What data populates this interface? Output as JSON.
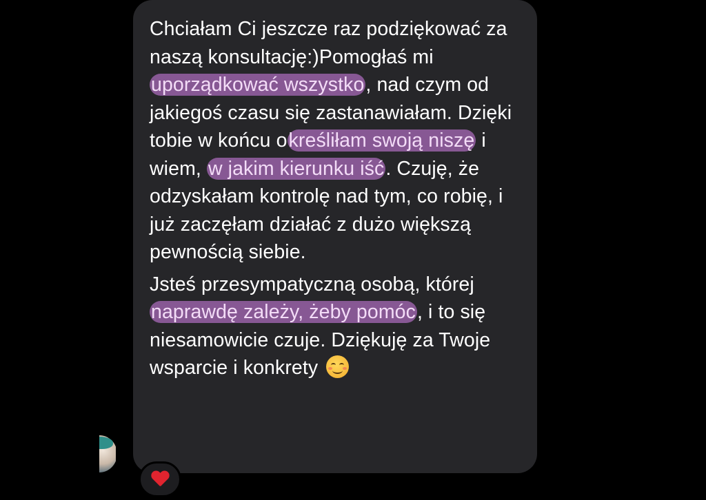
{
  "message": {
    "paragraph1": [
      {
        "text": "Chciałam Ci jeszcze raz podziękować za naszą konsultację:)Pomogłaś mi ",
        "highlight": false
      },
      {
        "text": "uporządkować wszystko",
        "highlight": true
      },
      {
        "text": ", nad czym od jakiegoś czasu się zastanawiałam. Dzięki tobie w końcu o",
        "highlight": false
      },
      {
        "text": "kreśliłam swoją niszę",
        "highlight": true
      },
      {
        "text": " i wiem, ",
        "highlight": false
      },
      {
        "text": "w jakim kierunku iść",
        "highlight": true
      },
      {
        "text": ". Czuję, że odzyskałam kontrolę nad tym, co robię, i już zaczęłam działać z dużo większą pewnością siebie.",
        "highlight": false
      }
    ],
    "paragraph2": [
      {
        "text": "Jsteś przesympatyczną osobą, której ",
        "highlight": false
      },
      {
        "text": "naprawdę zależy, żeby pomóc",
        "highlight": true
      },
      {
        "text": ", i to się niesamowicie czuje. Dziękuję za Twoje wsparcie i konkrety",
        "highlight": false
      }
    ],
    "emoji": "smiling-face-icon"
  },
  "reaction": {
    "emoji": "heart-icon",
    "color": "#e0242f"
  },
  "colors": {
    "background": "#000000",
    "bubble": "#262629",
    "highlight": "#c478d6",
    "text": "#ffffff"
  }
}
